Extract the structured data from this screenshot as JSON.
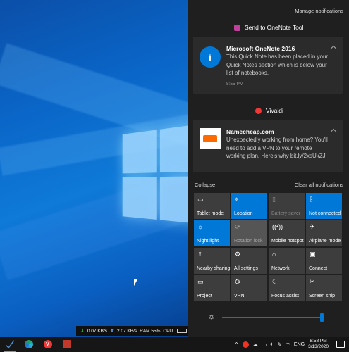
{
  "action_center": {
    "manage_label": "Manage notifications",
    "groups": [
      {
        "app": "Send to OneNote Tool",
        "notification": {
          "title": "Microsoft OneNote 2016",
          "body": "This Quick Note has been placed in your Quick Notes section which is below your list of notebooks.",
          "time": "8:55 PM",
          "icon": "info-icon"
        }
      },
      {
        "app": "Vivaldi",
        "notification": {
          "title": "Namecheap.com",
          "body": "Unexpectedly working from home? You'll need to add a VPN to your remote working plan. Here's why bit.ly/2xsUkZJ",
          "icon": "namecheap-logo-icon"
        }
      }
    ],
    "collapse_label": "Collapse",
    "clear_all_label": "Clear all notifications",
    "quick_actions": [
      {
        "label": "Tablet mode",
        "icon": "tablet-mode-icon",
        "state": "off"
      },
      {
        "label": "Location",
        "icon": "location-icon",
        "state": "on"
      },
      {
        "label": "Battery saver",
        "icon": "battery-saver-icon",
        "state": "disabled"
      },
      {
        "label": "Not connected",
        "icon": "bluetooth-icon",
        "state": "on"
      },
      {
        "label": "Night light",
        "icon": "night-light-icon",
        "state": "on"
      },
      {
        "label": "Rotation lock",
        "icon": "rotation-lock-icon",
        "state": "dim"
      },
      {
        "label": "Mobile hotspot",
        "icon": "mobile-hotspot-icon",
        "state": "off"
      },
      {
        "label": "Airplane mode",
        "icon": "airplane-mode-icon",
        "state": "off"
      },
      {
        "label": "Nearby sharing",
        "icon": "nearby-sharing-icon",
        "state": "off"
      },
      {
        "label": "All settings",
        "icon": "settings-icon",
        "state": "off"
      },
      {
        "label": "Network",
        "icon": "network-icon",
        "state": "off"
      },
      {
        "label": "Connect",
        "icon": "connect-icon",
        "state": "off"
      },
      {
        "label": "Project",
        "icon": "project-icon",
        "state": "off"
      },
      {
        "label": "VPN",
        "icon": "vpn-icon",
        "state": "off"
      },
      {
        "label": "Focus assist",
        "icon": "focus-assist-icon",
        "state": "off"
      },
      {
        "label": "Screen snip",
        "icon": "screen-snip-icon",
        "state": "off"
      }
    ],
    "brightness": {
      "value_percent": 100
    }
  },
  "net_meter": {
    "down": "0.07 KB/s",
    "up": "2.07 KB/s",
    "ram": "RAM 55%",
    "cpu": "CPU"
  },
  "taskbar": {
    "apps": [
      {
        "name": "visual-studio-icon",
        "active": true
      },
      {
        "name": "edge-icon",
        "active": false
      },
      {
        "name": "vivaldi-icon",
        "active": false
      },
      {
        "name": "app-icon",
        "active": false
      }
    ],
    "language": "ENG",
    "time": "8:58 PM",
    "date": "3/13/2020"
  },
  "colors": {
    "accent": "#0078d7",
    "panel_bg": "#1f1f1f",
    "card_bg": "#2b2b2b",
    "tile_bg": "#3d3d3d"
  }
}
